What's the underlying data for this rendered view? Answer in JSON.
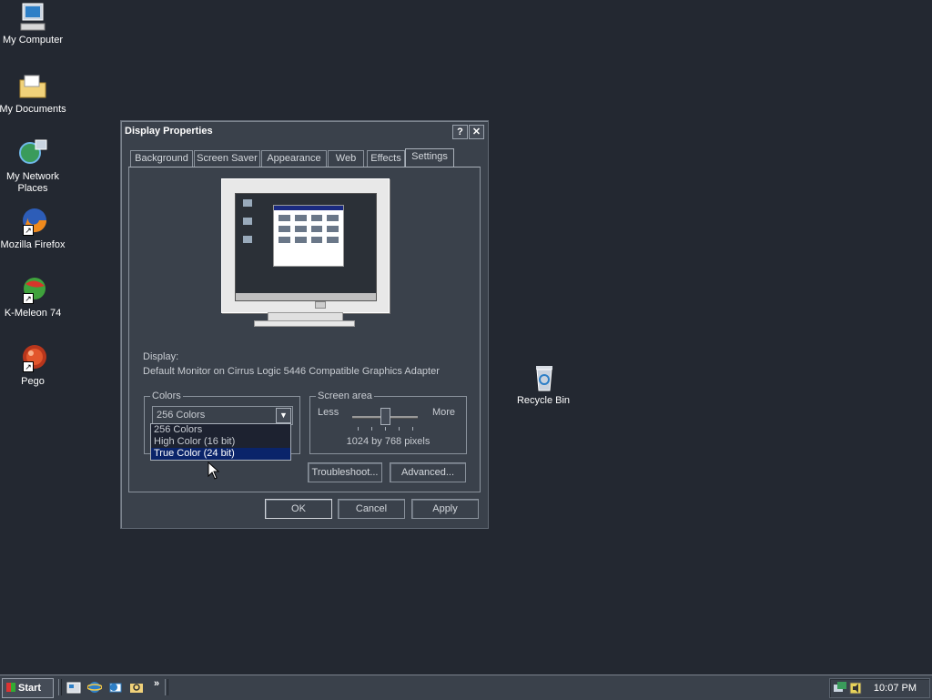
{
  "desktop": {
    "icons": [
      {
        "label": "My Computer",
        "icon": "computer-icon"
      },
      {
        "label": "My Documents",
        "icon": "folder-documents-icon"
      },
      {
        "label": "My Network Places",
        "icon": "network-icon"
      },
      {
        "label": "Mozilla Firefox",
        "icon": "firefox-icon"
      },
      {
        "label": "K-Meleon 74",
        "icon": "kmeleon-icon"
      },
      {
        "label": "Pego",
        "icon": "pego-icon"
      },
      {
        "label": "Recycle Bin",
        "icon": "recycle-bin-icon"
      }
    ]
  },
  "dialog": {
    "title": "Display Properties",
    "help_btn": "?",
    "close_btn": "✕",
    "tabs": [
      "Background",
      "Screen Saver",
      "Appearance",
      "Web",
      "Effects",
      "Settings"
    ],
    "active_tab": "Settings",
    "display_label": "Display:",
    "display_value": "Default Monitor on Cirrus Logic 5446 Compatible Graphics Adapter",
    "colors": {
      "title": "Colors",
      "selected": "256 Colors",
      "options": [
        "256 Colors",
        "High Color (16 bit)",
        "True Color (24 bit)"
      ],
      "highlighted": "True Color (24 bit)"
    },
    "screen_area": {
      "title": "Screen area",
      "less": "Less",
      "more": "More",
      "value": "1024 by 768 pixels",
      "slider_level": 0.5
    },
    "troubleshoot_btn": "Troubleshoot...",
    "advanced_btn": "Advanced...",
    "ok_btn": "OK",
    "cancel_btn": "Cancel",
    "apply_btn": "Apply"
  },
  "taskbar": {
    "start_label": "Start",
    "chevron": "»",
    "clock": "10:07 PM"
  }
}
